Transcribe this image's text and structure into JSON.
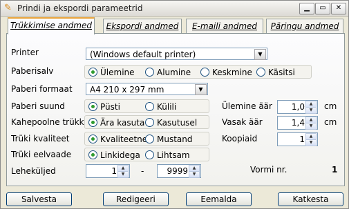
{
  "window": {
    "title": "Prindi ja ekspordi parameetrid",
    "icon": "pencil-icon"
  },
  "tabs": [
    "Trükkimise andmed",
    "Ekspordi andmed",
    "E-maili andmed",
    "Päringu andmed"
  ],
  "printer": {
    "label": "Printer",
    "value": "(Windows default printer)"
  },
  "paper_tray": {
    "label": "Paberisalv",
    "options": [
      "Ülemine",
      "Alumine",
      "Keskmine",
      "Käsitsi"
    ],
    "selected": "Ülemine"
  },
  "paper_format": {
    "label": "Paberi formaat",
    "value": "A4 210 x 297 mm"
  },
  "orientation": {
    "label": "Paberi suund",
    "options": [
      "Püsti",
      "Külili"
    ],
    "selected": "Püsti"
  },
  "duplex": {
    "label": "Kahepoolne trükk",
    "options": [
      "Ära kasuta",
      "Kasutusel"
    ],
    "selected": "Ära kasuta"
  },
  "quality": {
    "label": "Trüki kvaliteet",
    "options": [
      "Kvaliteetne",
      "Mustand"
    ],
    "selected": "Kvaliteetne"
  },
  "preview": {
    "label": "Trüki eelvaade",
    "options": [
      "Linkidega",
      "Lihtsam"
    ],
    "selected": "Linkidega"
  },
  "pages": {
    "label": "Leheküljed",
    "from": "1",
    "separator": "-",
    "to": "9999"
  },
  "margins": {
    "top": {
      "label": "Ülemine äär",
      "value": "1,0",
      "unit": "cm"
    },
    "left": {
      "label": "Vasak äär",
      "value": "1,4",
      "unit": "cm"
    }
  },
  "copies": {
    "label": "Koopiaid",
    "value": "1"
  },
  "form": {
    "label": "Vormi nr.",
    "value": "1"
  },
  "buttons": {
    "save": "Salvesta",
    "edit": "Redigeeri",
    "remove": "Eemalda",
    "cancel": "Katkesta"
  }
}
